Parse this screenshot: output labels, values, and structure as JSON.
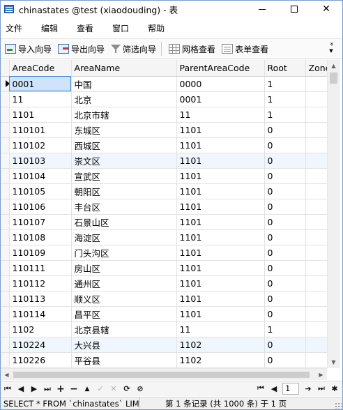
{
  "window": {
    "title": "chinastates @test (xiaodouding) - 表",
    "minimize_icon": "minimize-icon",
    "maximize_icon": "maximize-icon",
    "close_label": "✕"
  },
  "menu": [
    "文件",
    "编辑",
    "查看",
    "窗口",
    "帮助"
  ],
  "toolbar": {
    "import": "导入向导",
    "export": "导出向导",
    "filter": "筛选向导",
    "grid_view": "网格查看",
    "form_view": "表单查看",
    "overflow": "»"
  },
  "table": {
    "columns": [
      "AreaCode",
      "AreaName",
      "ParentAreaCode",
      "Root",
      "Zone"
    ],
    "rows": [
      [
        "0001",
        "中国",
        "0000",
        "1"
      ],
      [
        "11",
        "北京",
        "0001",
        "1"
      ],
      [
        "1101",
        "北京市辖",
        "11",
        "1"
      ],
      [
        "110101",
        "东城区",
        "1101",
        "0"
      ],
      [
        "110102",
        "西城区",
        "1101",
        "0"
      ],
      [
        "110103",
        "崇文区",
        "1101",
        "0"
      ],
      [
        "110104",
        "宣武区",
        "1101",
        "0"
      ],
      [
        "110105",
        "朝阳区",
        "1101",
        "0"
      ],
      [
        "110106",
        "丰台区",
        "1101",
        "0"
      ],
      [
        "110107",
        "石景山区",
        "1101",
        "0"
      ],
      [
        "110108",
        "海淀区",
        "1101",
        "0"
      ],
      [
        "110109",
        "门头沟区",
        "1101",
        "0"
      ],
      [
        "110111",
        "房山区",
        "1101",
        "0"
      ],
      [
        "110112",
        "通州区",
        "1101",
        "0"
      ],
      [
        "110113",
        "顺义区",
        "1101",
        "0"
      ],
      [
        "110114",
        "昌平区",
        "1101",
        "0"
      ],
      [
        "1102",
        "北京县辖",
        "11",
        "1"
      ],
      [
        "110224",
        "大兴县",
        "1102",
        "0"
      ],
      [
        "110226",
        "平谷县",
        "1102",
        "0"
      ]
    ]
  },
  "navbar": {
    "first": "⏮",
    "prev": "◀",
    "next": "▶",
    "last": "⏭",
    "add": "+",
    "delete": "−",
    "up": "▲",
    "apply": "✓",
    "cancel": "✕",
    "refresh": "⟳",
    "stop": "⊘",
    "page_first": "⏮",
    "page_prev": "◀",
    "page_number": "1",
    "page_next": "➔",
    "page_last": "⏭",
    "settings": "✱"
  },
  "status": {
    "sql": "SELECT * FROM `chinastates` LIMI",
    "records": "第 1 条记录 (共 1000 条) 于 1 页"
  }
}
